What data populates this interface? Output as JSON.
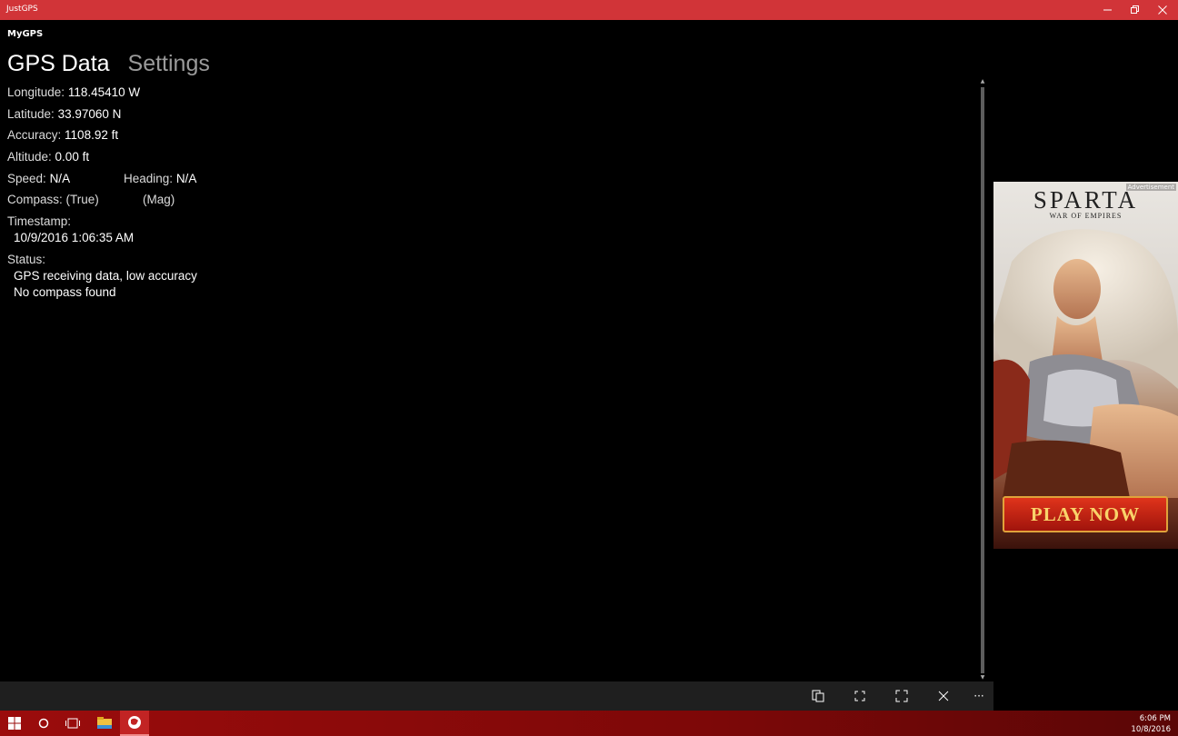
{
  "window": {
    "title": "JustGPS"
  },
  "app": {
    "header": "MyGPS"
  },
  "pivot": {
    "tabs": [
      {
        "label": "GPS Data",
        "active": true
      },
      {
        "label": "Settings",
        "active": false
      }
    ]
  },
  "gps": {
    "longitude_label": "Longitude:",
    "longitude_value": "118.45410 W",
    "latitude_label": "Latitude:",
    "latitude_value": "33.97060 N",
    "accuracy_label": "Accuracy:",
    "accuracy_value": "1108.92 ft",
    "altitude_label": "Altitude:",
    "altitude_value": "0.00 ft",
    "speed_label": "Speed:",
    "speed_value": "N/A",
    "heading_label": "Heading:",
    "heading_value": "N/A",
    "compass_label": "Compass:",
    "compass_true": "(True)",
    "compass_mag": "(Mag)",
    "timestamp_label": "Timestamp:",
    "timestamp_value": "10/9/2016 1:06:35 AM",
    "status_label": "Status:",
    "status_line1": "GPS receiving data, low accuracy",
    "status_line2": "No compass found"
  },
  "ad": {
    "label": "Advertisement",
    "title": "SPARTA",
    "subtitle": "WAR OF EMPIRES",
    "cta": "PLAY NOW"
  },
  "appbar": {
    "icons": [
      "copy-icon",
      "compact-overlay-icon",
      "fullscreen-icon",
      "close-icon",
      "more-icon"
    ],
    "more": "···"
  },
  "taskbar": {
    "time": "6:06 PM",
    "date": "10/8/2016"
  },
  "colors": {
    "accent": "#d13438",
    "taskbar": "#8b0a0a",
    "background": "#000000"
  }
}
